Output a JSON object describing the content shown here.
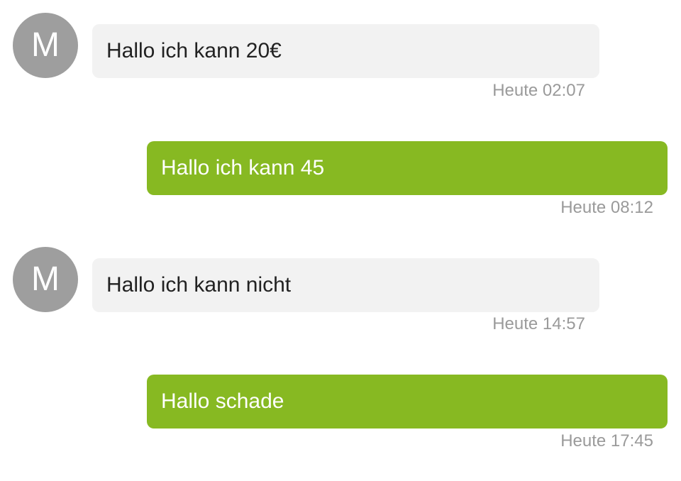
{
  "conversation": {
    "contact_initial": "M",
    "colors": {
      "avatar": "#9e9e9e",
      "incoming_bubble": "#f2f2f2",
      "outgoing_bubble": "#87b922",
      "timestamp": "#9a9a9a"
    },
    "messages": [
      {
        "direction": "incoming",
        "text": "Hallo ich kann 20€",
        "time": "Heute 02:07"
      },
      {
        "direction": "outgoing",
        "text": "Hallo ich kann 45",
        "time": "Heute 08:12"
      },
      {
        "direction": "incoming",
        "text": "Hallo ich kann nicht",
        "time": "Heute 14:57"
      },
      {
        "direction": "outgoing",
        "text": "Hallo schade",
        "time": "Heute 17:45"
      }
    ]
  }
}
